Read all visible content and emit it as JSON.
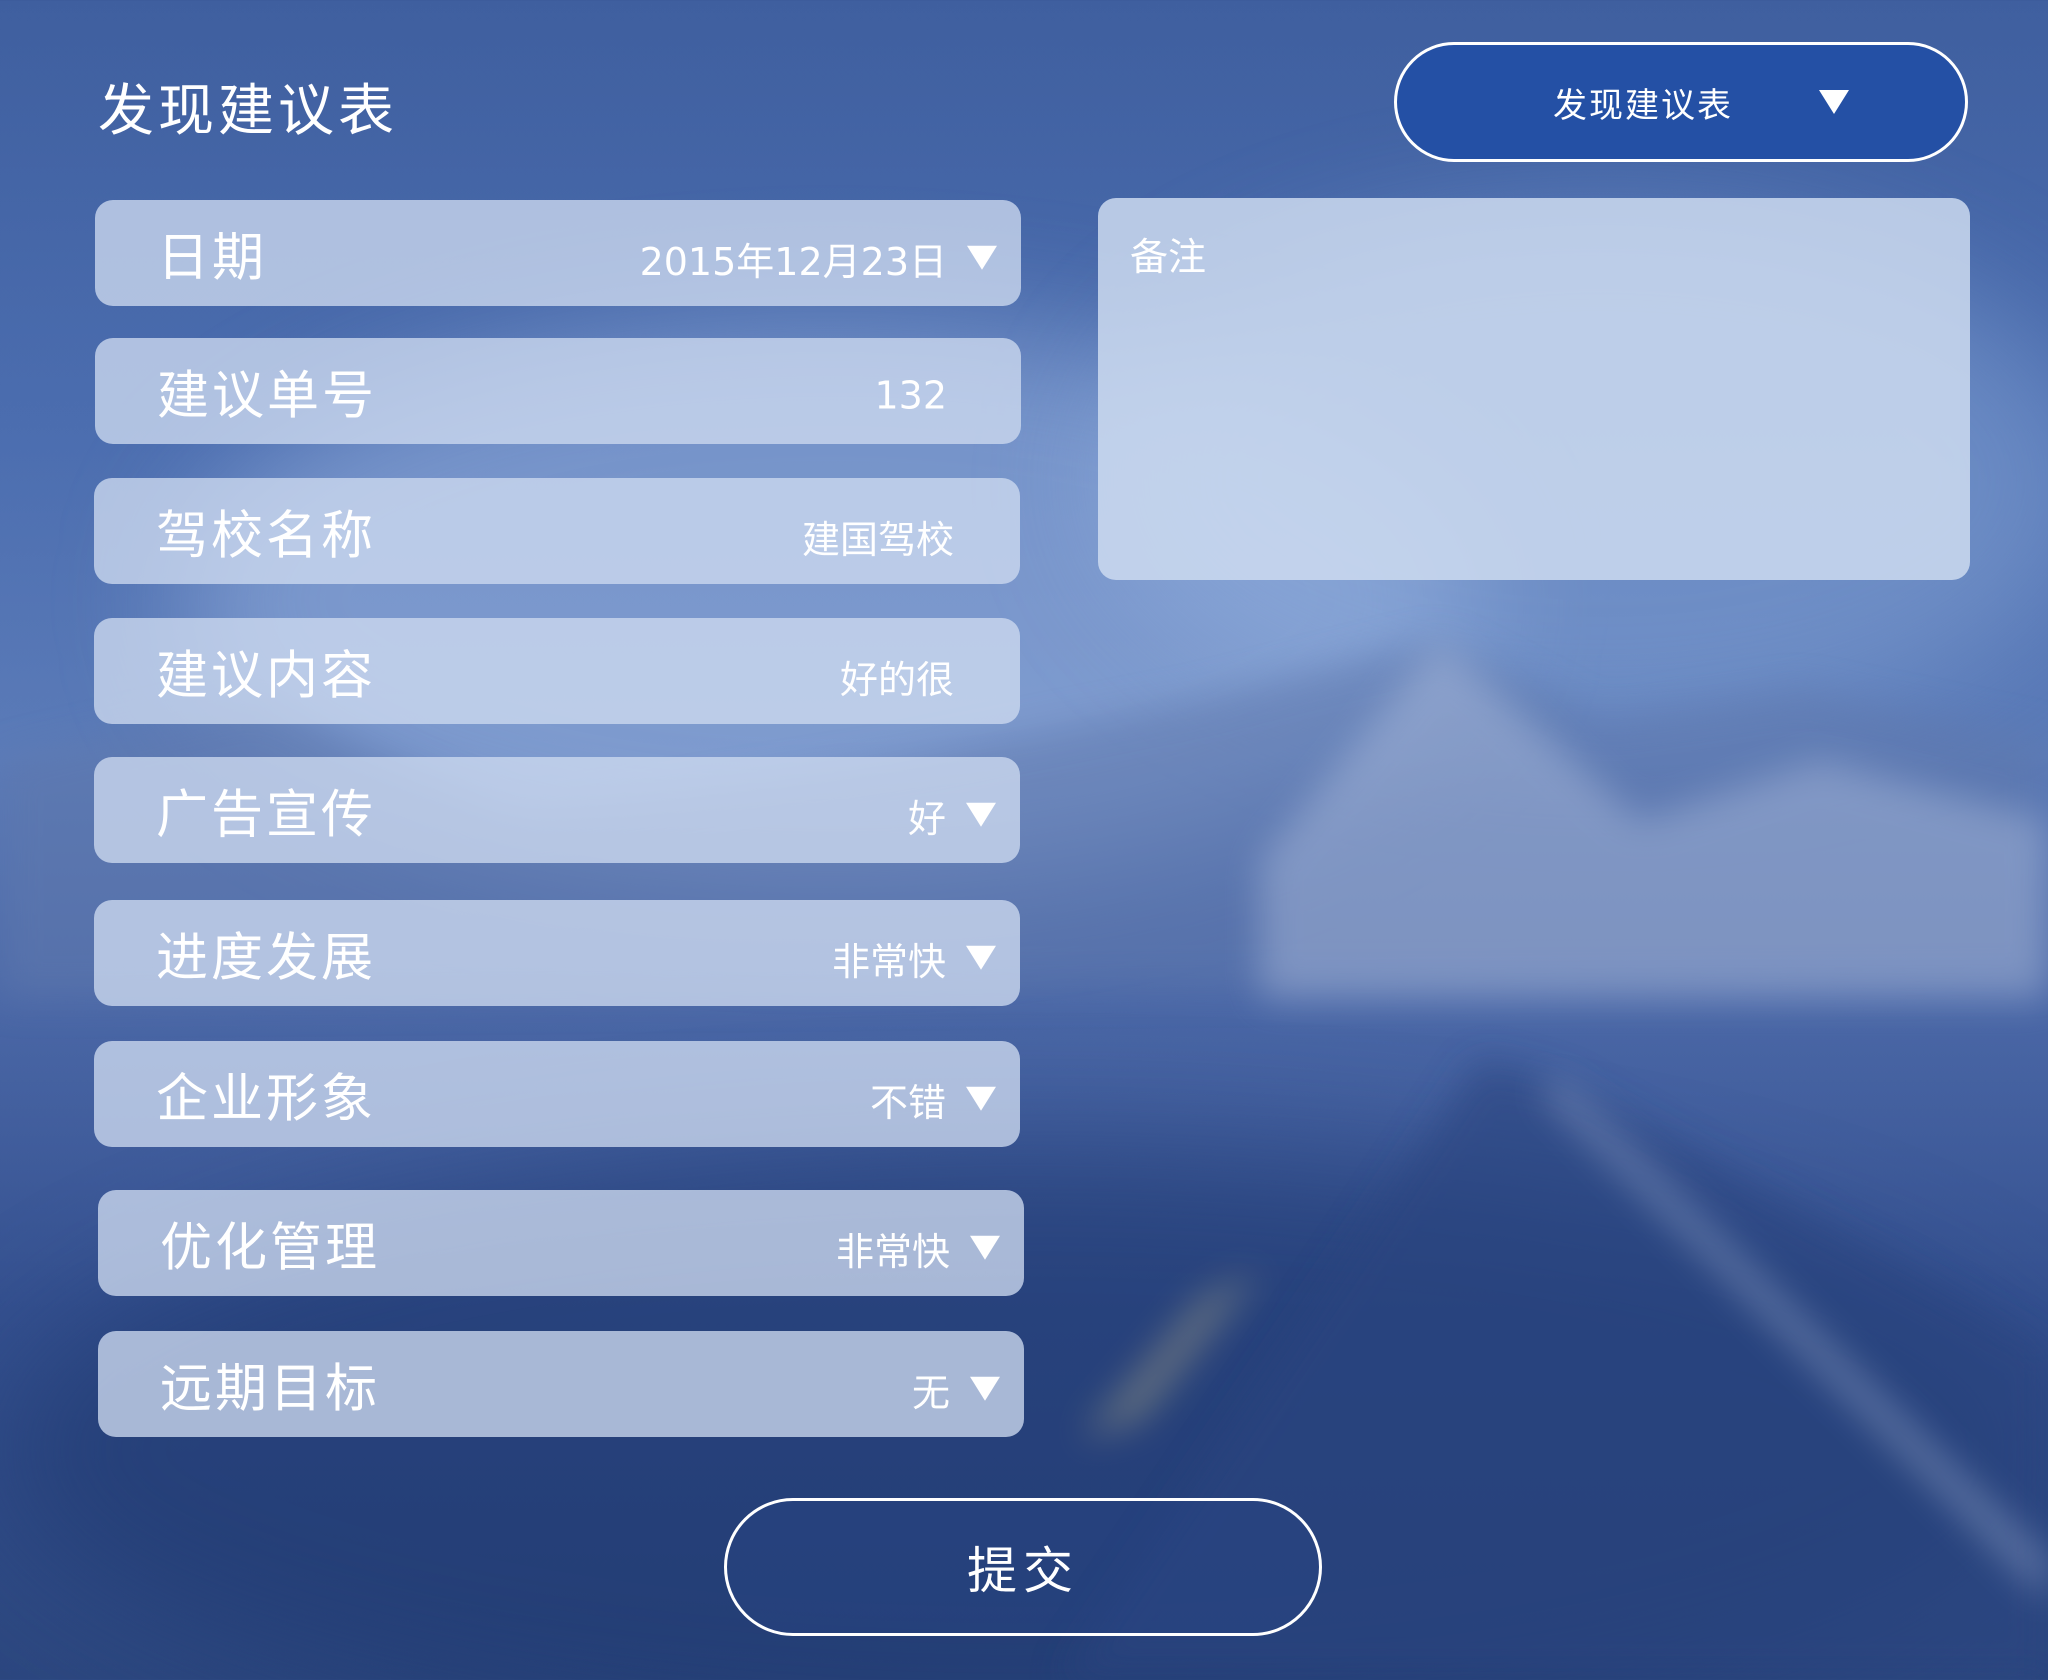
{
  "page": {
    "title": "发现建议表"
  },
  "form_type_select": {
    "selected": "发现建议表"
  },
  "fields": [
    {
      "label": "日期",
      "value": "2015年12月23日",
      "dropdown": true
    },
    {
      "label": "建议单号",
      "value": "132",
      "dropdown": false
    },
    {
      "label": "驾校名称",
      "value": "建国驾校",
      "dropdown": false
    },
    {
      "label": "建议内容",
      "value": "好的很",
      "dropdown": false
    },
    {
      "label": "广告宣传",
      "value": "好",
      "dropdown": true
    },
    {
      "label": "进度发展",
      "value": "非常快",
      "dropdown": true
    },
    {
      "label": "企业形象",
      "value": "不错",
      "dropdown": true
    },
    {
      "label": "优化管理",
      "value": "非常快",
      "dropdown": true
    },
    {
      "label": "远期目标",
      "value": "无",
      "dropdown": true
    }
  ],
  "remarks": {
    "placeholder": "备注"
  },
  "submit": {
    "label": "提交"
  },
  "icons": {
    "dropdown": "triangle-down-icon"
  },
  "colors": {
    "primary_blue": "#2450a5",
    "field_bg": "#cddaf0",
    "text": "#ffffff"
  }
}
